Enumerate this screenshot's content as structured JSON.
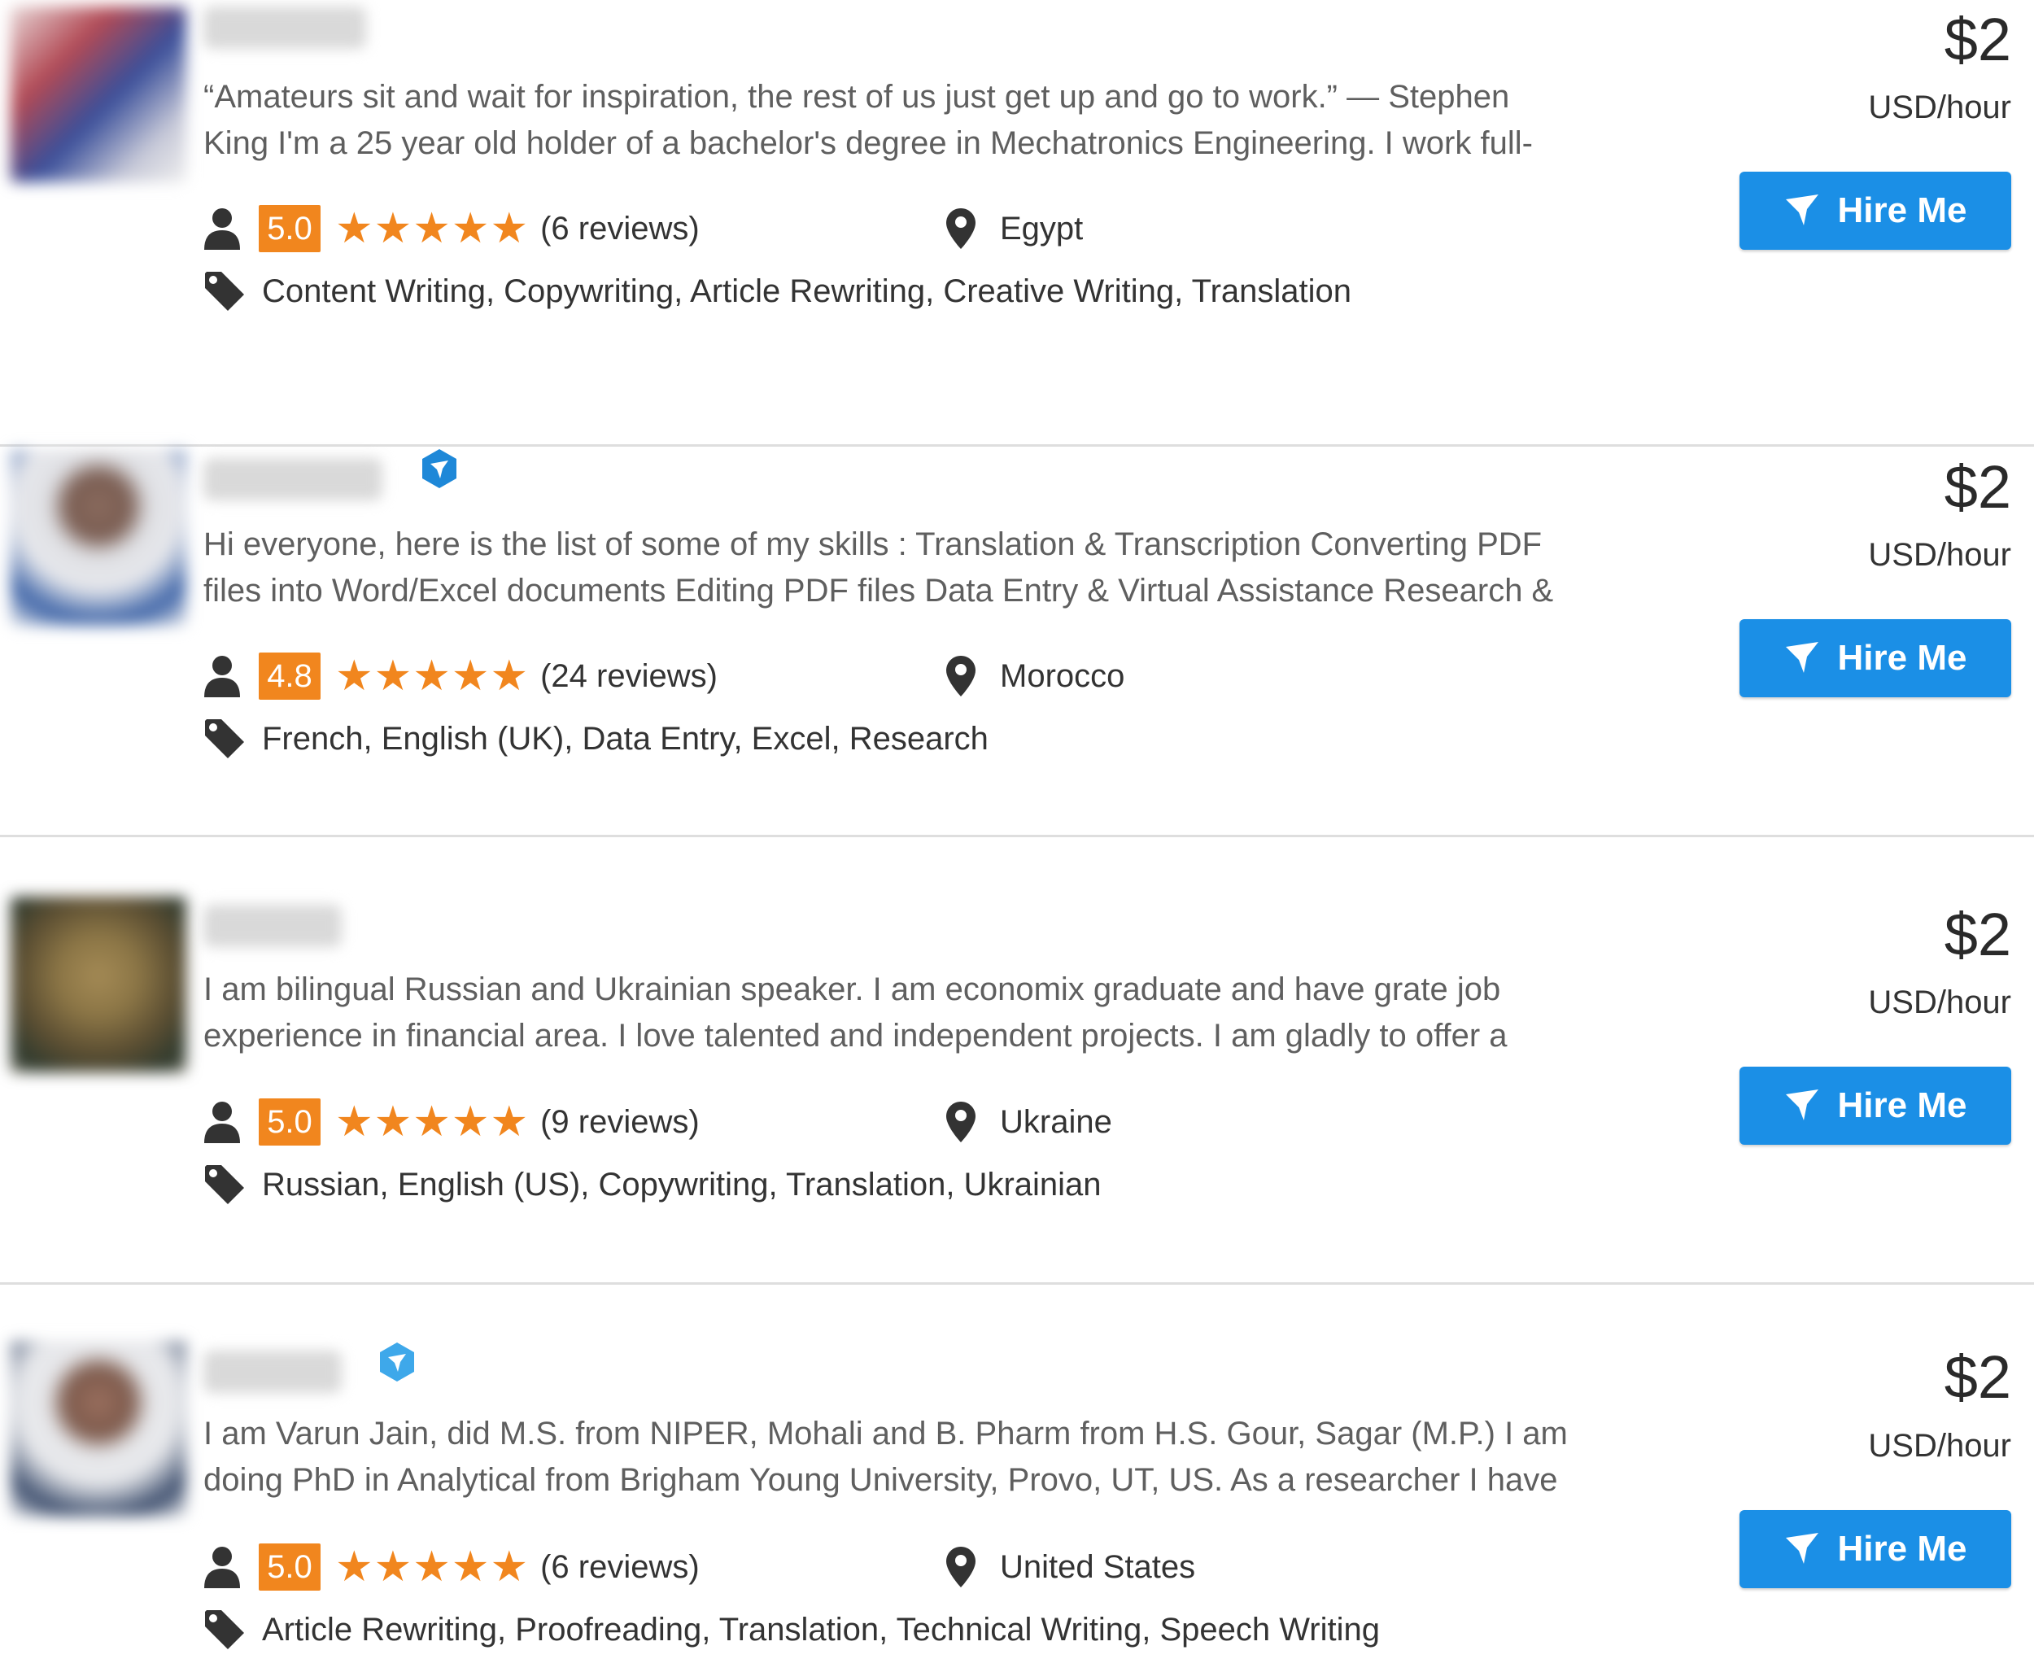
{
  "freelancers": [
    {
      "verified": false,
      "description_line1": "“Amateurs sit and wait for inspiration, the rest of us just get up and go to work.” — Stephen",
      "description_line2": "King I'm a 25 year old holder of a bachelor's degree in Mechatronics Engineering. I work full-",
      "rating": "5.0",
      "stars": "★★★★★",
      "reviews": "(6 reviews)",
      "country": "Egypt",
      "skills": "Content Writing, Copywriting, Article Rewriting, Creative Writing, Translation",
      "price": "$2",
      "price_unit": "USD/hour",
      "hire_label": "Hire Me"
    },
    {
      "verified": true,
      "description_line1": "Hi everyone, here is the list of some of my skills : Translation & Transcription Converting PDF",
      "description_line2": "files into Word/Excel documents Editing PDF files Data Entry & Virtual Assistance Research &",
      "rating": "4.8",
      "stars": "★★★★★",
      "reviews": "(24 reviews)",
      "country": "Morocco",
      "skills": "French, English (UK), Data Entry, Excel, Research",
      "price": "$2",
      "price_unit": "USD/hour",
      "hire_label": "Hire Me"
    },
    {
      "verified": false,
      "description_line1": "I am bilingual Russian and Ukrainian speaker. I am economix graduate and have grate job",
      "description_line2": "experience in financial area. I love talented and independent projects. I am gladly to offer a",
      "rating": "5.0",
      "stars": "★★★★★",
      "reviews": "(9 reviews)",
      "country": "Ukraine",
      "skills": "Russian, English (US), Copywriting, Translation, Ukrainian",
      "price": "$2",
      "price_unit": "USD/hour",
      "hire_label": "Hire Me"
    },
    {
      "verified": true,
      "description_line1": "I am Varun Jain, did M.S. from NIPER, Mohali and B. Pharm from H.S. Gour, Sagar (M.P.) I am",
      "description_line2": "doing PhD in Analytical from Brigham Young University, Provo, UT, US. As a researcher I have",
      "rating": "5.0",
      "stars": "★★★★★",
      "reviews": "(6 reviews)",
      "country": "United States",
      "skills": "Article Rewriting, Proofreading, Translation, Technical Writing, Speech Writing",
      "price": "$2",
      "price_unit": "USD/hour",
      "hire_label": "Hire Me"
    }
  ],
  "colors": {
    "accent_orange": "#f1861e",
    "button_blue": "#1b8fe6",
    "verified_blue": "#1e88d8"
  },
  "icons": [
    "user-icon",
    "star-icon",
    "location-pin-icon",
    "tag-icon",
    "verified-badge-icon",
    "hire-bird-icon"
  ]
}
